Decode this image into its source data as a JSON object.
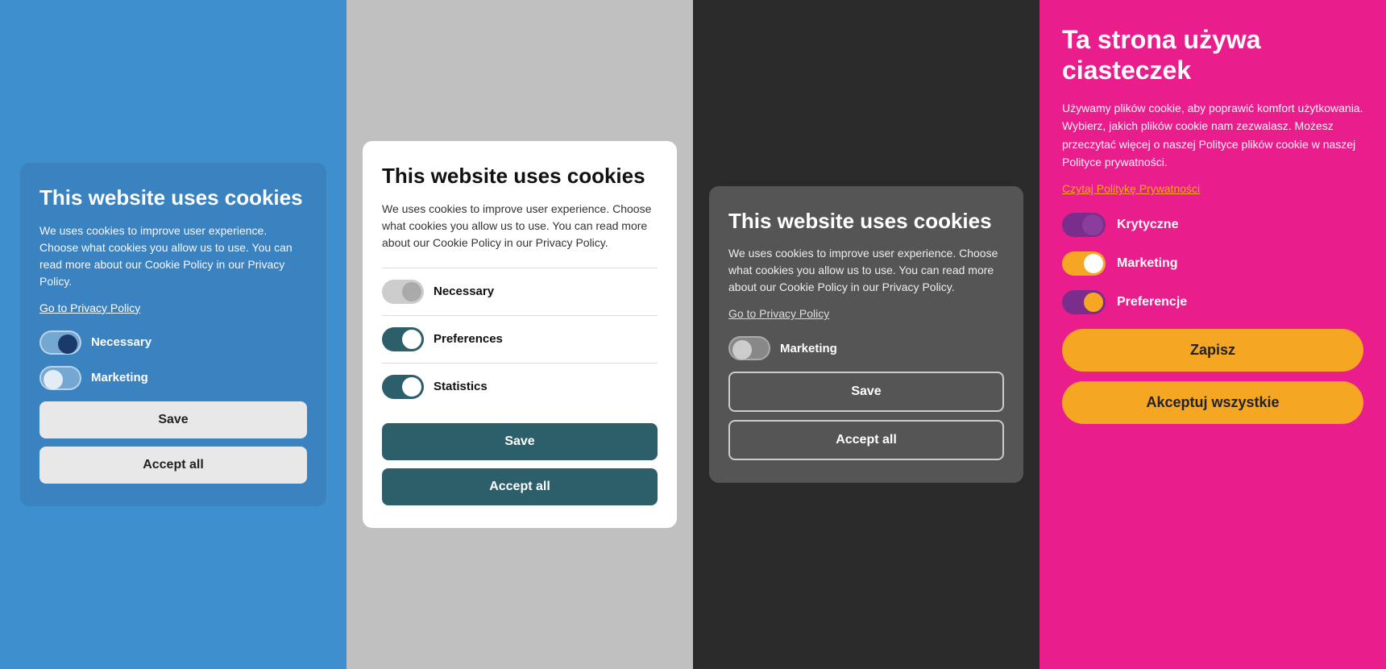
{
  "panel1": {
    "title": "This website uses cookies",
    "description": "We uses cookies to improve user experience. Choose what cookies you allow us to use. You can read more about our Cookie Policy in our Privacy Policy.",
    "privacy_link": "Go to Privacy Policy",
    "toggles": [
      {
        "label": "Necessary",
        "state": "on"
      },
      {
        "label": "Marketing",
        "state": "off"
      }
    ],
    "btn_save": "Save",
    "btn_accept": "Accept all"
  },
  "panel2": {
    "title": "This website uses cookies",
    "description": "We uses cookies to improve user experience. Choose what cookies you allow us to use. You can read more about our Cookie Policy in our Privacy Policy.",
    "toggles": [
      {
        "label": "Necessary",
        "state": "off"
      },
      {
        "label": "Preferences",
        "state": "on"
      },
      {
        "label": "Statistics",
        "state": "on"
      }
    ],
    "btn_save": "Save",
    "btn_accept": "Accept all"
  },
  "panel3": {
    "title": "This website uses cookies",
    "description": "We uses cookies to improve user experience. Choose what cookies you allow us to use. You can read more about our Cookie Policy in our Privacy Policy.",
    "privacy_link": "Go to Privacy Policy",
    "toggles": [
      {
        "label": "Marketing",
        "state": "off"
      }
    ],
    "btn_save": "Save",
    "btn_accept": "Accept all"
  },
  "panel4": {
    "title": "Ta strona używa ciasteczek",
    "description": "Używamy plików cookie, aby poprawić komfort użytkowania. Wybierz, jakich plików cookie nam zezwalasz. Możesz przeczytać więcej o naszej Polityce plików cookie w naszej Polityce prywatności.",
    "privacy_link": "Czytaj Politykę Prywatności",
    "toggles": [
      {
        "label": "Krytyczne",
        "state": "on"
      },
      {
        "label": "Marketing",
        "state": "on"
      },
      {
        "label": "Preferencje",
        "state": "partial"
      }
    ],
    "btn_save": "Zapisz",
    "btn_accept": "Akceptuj wszystkie"
  }
}
